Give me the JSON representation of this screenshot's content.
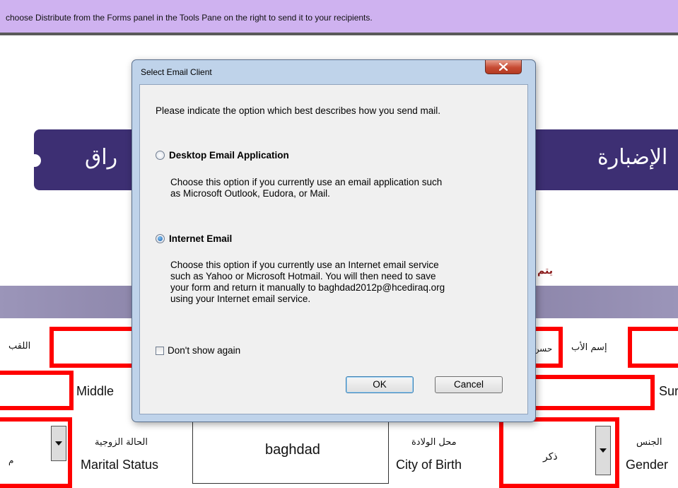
{
  "infobar": {
    "text": "choose Distribute from the Forms panel in the Tools Pane on the right to send it to your recipients."
  },
  "form_bg": {
    "banner_left_text": "راق",
    "banner_right_text": "الإضبارة",
    "subtitle_ar": "يتم",
    "surname_label_ar": "اللقب",
    "father_label_ar": "إسم الأب",
    "father_value": "حسن",
    "middle_label_en": "Middle",
    "surname_label_en": "Sur",
    "marital_label_ar": "الحالة الزوجية",
    "marital_label_en": "Marital Status",
    "city_value": "baghdad",
    "city_label_ar": "محل الولادة",
    "city_label_en": "City of Birth",
    "gender_value": "ذكر",
    "gender_label_ar": "الجنس",
    "gender_label_en": "Gender",
    "left_edge_ar": "م"
  },
  "dialog": {
    "title": "Select Email Client",
    "intro": "Please indicate the option which best describes how you send mail.",
    "option_desktop": {
      "label": "Desktop Email Application",
      "selected": false,
      "desc_line1": "Choose this option if you currently use an email application such",
      "desc_line2": "as Microsoft Outlook, Eudora, or Mail."
    },
    "option_internet": {
      "label": "Internet Email",
      "selected": true,
      "desc_line1": "Choose this option if you currently use an Internet email service",
      "desc_line2": "such as Yahoo or Microsoft Hotmail. You will then need to save",
      "desc_line3": "your form and return it manually to baghdad2012p@hcediraq.org",
      "desc_line4": "using your Internet email service."
    },
    "dont_show_again": "Don't show again",
    "ok_label": "OK",
    "cancel_label": "Cancel"
  },
  "colors": {
    "infobar": "#cfb2f0",
    "banner": "#3d2f73",
    "field_border": "#ff0000",
    "dialog_frame": "#bfd3ea"
  }
}
